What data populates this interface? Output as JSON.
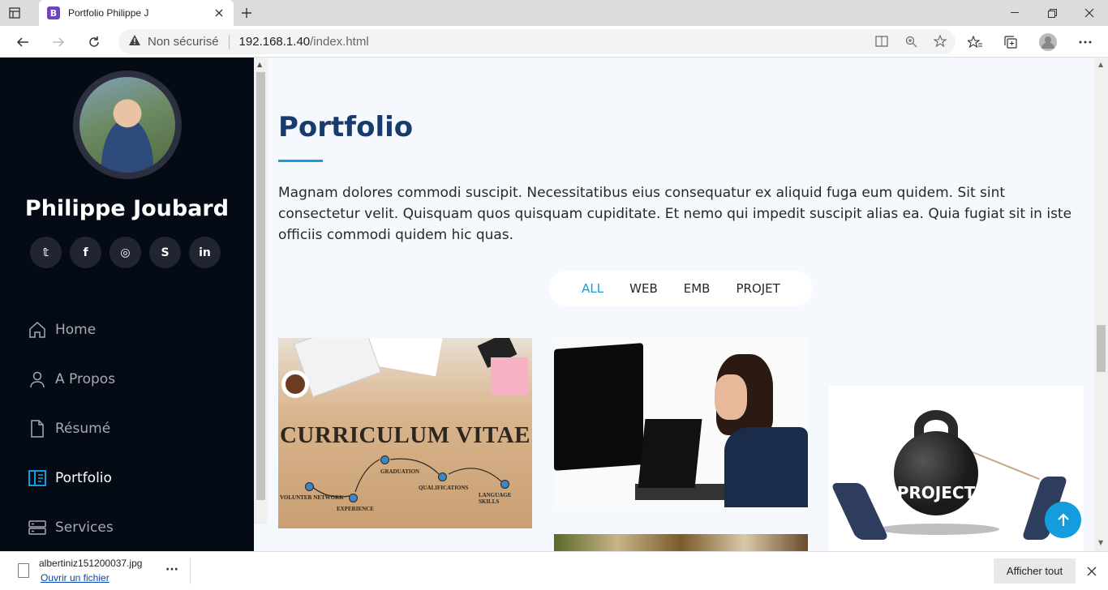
{
  "browser": {
    "tab_title": "Portfolio Philippe J",
    "tab_favicon": "B",
    "security_label": "Non sécurisé",
    "url_host": "192.168.1.40",
    "url_path": "/index.html"
  },
  "sidebar": {
    "profile_name": "Philippe Joubard",
    "social": [
      {
        "icon": "twitter-icon",
        "glyph": "𝕥"
      },
      {
        "icon": "facebook-icon",
        "glyph": "f"
      },
      {
        "icon": "instagram-icon",
        "glyph": "◎"
      },
      {
        "icon": "skype-icon",
        "glyph": "S"
      },
      {
        "icon": "linkedin-icon",
        "glyph": "in"
      }
    ],
    "nav": [
      {
        "label": "Home",
        "icon": "home-icon"
      },
      {
        "label": "A Propos",
        "icon": "person-icon"
      },
      {
        "label": "Résumé",
        "icon": "file-icon"
      },
      {
        "label": "Portfolio",
        "icon": "book-icon",
        "active": true
      },
      {
        "label": "Services",
        "icon": "server-icon"
      }
    ]
  },
  "main": {
    "title": "Portfolio",
    "description": "Magnam dolores commodi suscipit. Necessitatibus eius consequatur ex aliquid fuga eum quidem. Sit sint consectetur velit. Quisquam quos quisquam cupiditate. Et nemo qui impedit suscipit alias ea. Quia fugiat sit in iste officiis commodi quidem hic quas.",
    "filters": [
      "ALL",
      "WEB",
      "EMB",
      "PROJET"
    ],
    "active_filter": "ALL",
    "cards": {
      "cv_title": "CURRICULUM VITAE",
      "cv_steps": [
        "VOLUNTER NETWORK",
        "EXPERIENCE",
        "GRADUATION",
        "QUALIFICATIONS",
        "LANGUAGE SKILLS"
      ],
      "project_text": "PROJECT"
    }
  },
  "download": {
    "filename": "albertiniz151200037.jpg",
    "open_label": "Ouvrir un fichier",
    "show_all_label": "Afficher tout"
  },
  "colors": {
    "accent": "#149ddd",
    "sidebar_bg": "#040b14",
    "title": "#173b6c"
  }
}
